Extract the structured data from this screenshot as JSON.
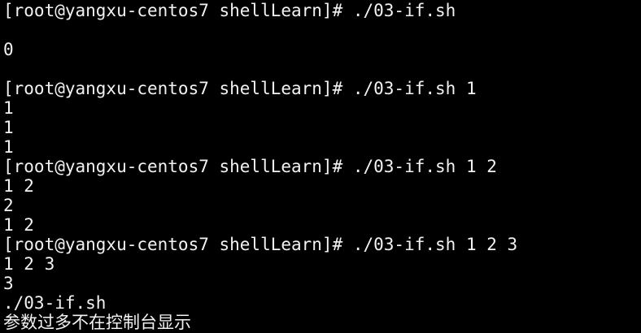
{
  "terminal": {
    "lines": [
      "[root@yangxu-centos7 shellLearn]# ./03-if.sh",
      "",
      "0",
      "",
      "[root@yangxu-centos7 shellLearn]# ./03-if.sh 1",
      "1",
      "1",
      "1",
      "[root@yangxu-centos7 shellLearn]# ./03-if.sh 1 2",
      "1 2",
      "2",
      "1 2",
      "[root@yangxu-centos7 shellLearn]# ./03-if.sh 1 2 3",
      "1 2 3",
      "3",
      "./03-if.sh",
      "参数过多不在控制台显示"
    ]
  },
  "colors": {
    "background": "#000000",
    "foreground": "#f2f2f2"
  }
}
